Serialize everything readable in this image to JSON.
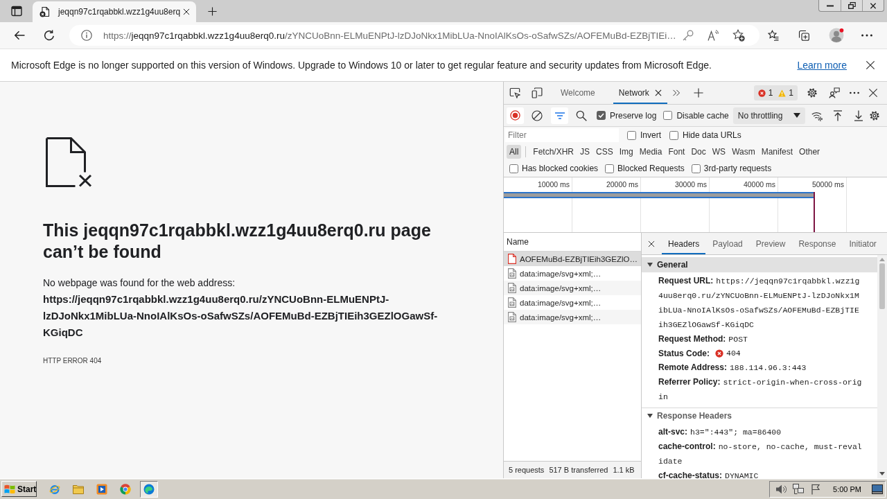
{
  "browser": {
    "tabs": [
      {
        "title": "jeqqn97c1rqabbkl.wzz1g4uu8erq",
        "selected": true
      }
    ],
    "address": {
      "scheme": "https://",
      "host": "jeqqn97c1rqabbkl.wzz1g4uu8erq0.ru",
      "path": "/zYNCUoBnn-ELMuENPtJ-lzDJoNkx1MibLUa-NnoIAlKsOs-oSafwSZs/AOFEMuBd-EZBjTIEi…"
    }
  },
  "infobar": {
    "message": "Microsoft Edge is no longer supported on this version of Windows. Upgrade to Windows 10 or later to get regular feature and security updates from Microsoft Edge.",
    "link": "Learn more"
  },
  "page": {
    "heading": "This jeqqn97c1rqabbkl.wzz1g4uu8erq0.ru page can’t be found",
    "message": "No webpage was found for the web address:",
    "url": "https://jeqqn97c1rqabbkl.wzz1g4uu8erq0.ru/zYNCUoBnn-ELMuENPtJ-lzDJoNkx1MibLUa-NnoIAlKsOs-oSafwSZs/AOFEMuBd-EZBjTIEih3GEZlOGawSf-KGiqDC",
    "error_code": "HTTP ERROR 404"
  },
  "devtools": {
    "tabs": [
      {
        "label": "Welcome",
        "selected": false,
        "closable": false
      },
      {
        "label": "Network",
        "selected": true,
        "closable": true
      }
    ],
    "issues": {
      "errors": "1",
      "warnings": "1"
    },
    "recording": true,
    "filter_bar_shown": true,
    "toolbar_options": [
      {
        "label": "Preserve log",
        "checked": true
      },
      {
        "label": "Disable cache",
        "checked": false
      }
    ],
    "throttling": "No throttling",
    "filter": {
      "placeholder": "Filter"
    },
    "filter_options": [
      {
        "label": "Invert",
        "checked": false
      },
      {
        "label": "Hide data URLs",
        "checked": false
      }
    ],
    "resource_types": [
      {
        "label": "All",
        "selected": true
      },
      {
        "label": "Fetch/XHR",
        "selected": false
      },
      {
        "label": "JS",
        "selected": false
      },
      {
        "label": "CSS",
        "selected": false
      },
      {
        "label": "Img",
        "selected": false
      },
      {
        "label": "Media",
        "selected": false
      },
      {
        "label": "Font",
        "selected": false
      },
      {
        "label": "Doc",
        "selected": false
      },
      {
        "label": "WS",
        "selected": false
      },
      {
        "label": "Wasm",
        "selected": false
      },
      {
        "label": "Manifest",
        "selected": false
      },
      {
        "label": "Other",
        "selected": false
      }
    ],
    "request_filters": [
      {
        "label": "Has blocked cookies",
        "checked": false
      },
      {
        "label": "Blocked Requests",
        "checked": false
      },
      {
        "label": "3rd-party requests",
        "checked": false
      }
    ],
    "overview": {
      "ticks": [
        "10000 ms",
        "20000 ms",
        "30000 ms",
        "40000 ms",
        "50000 ms"
      ]
    },
    "requests": {
      "column": "Name",
      "rows": [
        {
          "name": "AOFEMuBd-EZBjTIEih3GEZlO…",
          "kind": "document",
          "failed": true,
          "selected": true
        },
        {
          "name": "data:image/svg+xml;…",
          "kind": "image",
          "failed": false,
          "selected": false
        },
        {
          "name": "data:image/svg+xml;…",
          "kind": "image",
          "failed": false,
          "selected": false
        },
        {
          "name": "data:image/svg+xml;…",
          "kind": "image",
          "failed": false,
          "selected": false
        },
        {
          "name": "data:image/svg+xml;…",
          "kind": "image",
          "failed": false,
          "selected": false
        }
      ]
    },
    "summary": [
      "5 requests",
      "517 B transferred",
      "1.1 kB"
    ],
    "detail_tabs": [
      {
        "label": "Headers",
        "selected": true
      },
      {
        "label": "Payload",
        "selected": false
      },
      {
        "label": "Preview",
        "selected": false
      },
      {
        "label": "Response",
        "selected": false
      },
      {
        "label": "Initiator",
        "selected": false
      }
    ],
    "sections": [
      {
        "title": "General",
        "expanded": true,
        "selected": true,
        "rows": [
          {
            "name": "Request URL:",
            "value": "https://jeqqn97c1rqabbkl.wzz1g4uu8erq0.ru/zYNCUoBnn-ELMuENPtJ-lzDJoNkx1MibLUa-NnoIAlKsOs-oSafwSZs/AOFEMuBd-EZBjTIEih3GEZlOGawSf-KGiqDC",
            "error": false
          },
          {
            "name": "Request Method:",
            "value": "POST",
            "error": false
          },
          {
            "name": "Status Code:",
            "value": "404",
            "error": true
          },
          {
            "name": "Remote Address:",
            "value": "188.114.96.3:443",
            "error": false
          },
          {
            "name": "Referrer Policy:",
            "value": "strict-origin-when-cross-origin",
            "error": false
          }
        ]
      },
      {
        "title": "Response Headers",
        "expanded": true,
        "selected": false,
        "rows": [
          {
            "name": "alt-svc:",
            "value": "h3=\":443\"; ma=86400",
            "error": false
          },
          {
            "name": "cache-control:",
            "value": "no-store, no-cache, must-revalidate",
            "error": false
          },
          {
            "name": "cf-cache-status:",
            "value": "DYNAMIC",
            "error": false
          }
        ]
      }
    ]
  },
  "taskbar": {
    "start": "Start",
    "apps": [
      {
        "kind": "ie",
        "active": false
      },
      {
        "kind": "folder",
        "active": false
      },
      {
        "kind": "media",
        "active": false
      },
      {
        "kind": "chrome",
        "active": false
      },
      {
        "kind": "edge",
        "active": true
      }
    ],
    "clock": "5:00 PM"
  }
}
